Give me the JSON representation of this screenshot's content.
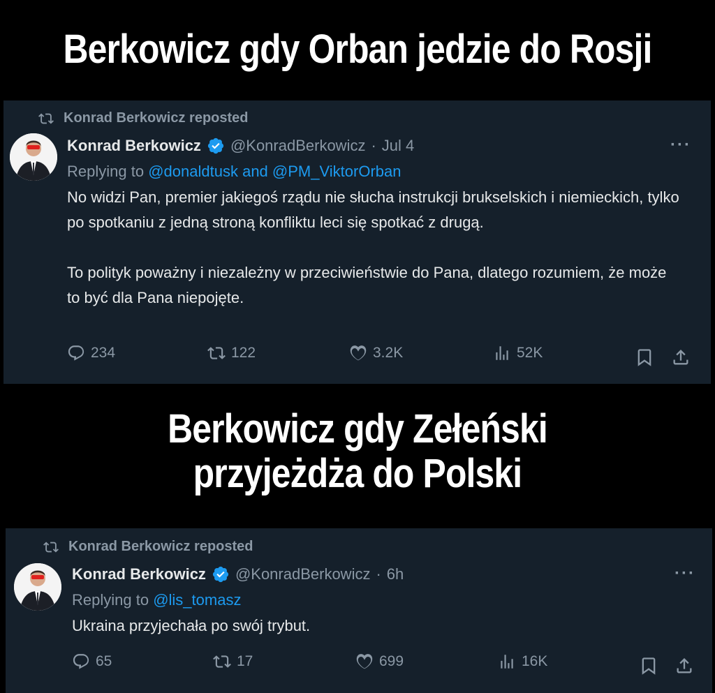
{
  "captions": {
    "top": "Berkowicz gdy Orban jedzie do Rosji",
    "middle_line1": "Berkowicz gdy Zełeński",
    "middle_line2": "przyjeżdża do Polski"
  },
  "tweets": [
    {
      "repost_label": "Konrad Berkowicz reposted",
      "name": "Konrad Berkowicz",
      "handle": "@KonradBerkowicz",
      "separator": "·",
      "time": "Jul 4",
      "replying_prefix": "Replying to",
      "mention1": "@donaldtusk",
      "conjunction": "and",
      "mention2": "@PM_ViktorOrban",
      "paragraph1": "No widzi Pan, premier jakiegoś rządu nie słucha instrukcji brukselskich i niemieckich, tylko po spotkaniu z jedną stroną konfliktu leci się spotkać z drugą.",
      "paragraph2": "To polityk poważny i niezależny w przeciwieństwie do Pana, dlatego rozumiem, że może to być dla Pana niepojęte.",
      "replies": "234",
      "reposts": "122",
      "likes": "3.2K",
      "views": "52K",
      "more": "···"
    },
    {
      "repost_label": "Konrad Berkowicz reposted",
      "name": "Konrad Berkowicz",
      "handle": "@KonradBerkowicz",
      "separator": "·",
      "time": "6h",
      "replying_prefix": "Replying to",
      "mention1": "@lis_tomasz",
      "paragraph1": "Ukraina przyjechała po swój trybut.",
      "replies": "65",
      "reposts": "17",
      "likes": "699",
      "views": "16K",
      "more": "···"
    }
  ],
  "icons": {
    "repost": "repost-icon",
    "verified": "verified-badge-icon",
    "reply": "reply-icon",
    "like": "heart-icon",
    "views": "views-icon",
    "bookmark": "bookmark-icon",
    "share": "share-icon"
  },
  "colors": {
    "background": "#000000",
    "card": "#15202b",
    "text": "#e7e9ea",
    "muted": "#8b98a5",
    "accent": "#1d9bf0"
  }
}
